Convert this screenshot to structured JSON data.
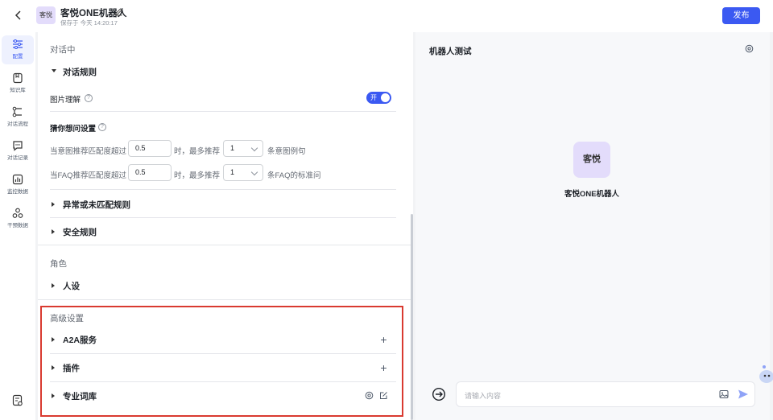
{
  "header": {
    "bot_logo_text": "客悦",
    "bot_name": "客悦ONE机器人",
    "save_time": "保存于 今天 14:20:17",
    "publish_label": "发布",
    "accent_color": "#3b59f2"
  },
  "sidebar": {
    "items": [
      {
        "label": "配置",
        "icon": "sliders-icon"
      },
      {
        "label": "知识库",
        "icon": "book-icon"
      },
      {
        "label": "对话流程",
        "icon": "flow-icon"
      },
      {
        "label": "对话记录",
        "icon": "chat-record-icon"
      },
      {
        "label": "监控数据",
        "icon": "chart-icon"
      },
      {
        "label": "干预数据",
        "icon": "nodes-icon"
      }
    ]
  },
  "config": {
    "section_dialog": "对话中",
    "dialog_rules": {
      "title": "对话规则",
      "image_understanding": {
        "label": "图片理解",
        "toggle_label": "开",
        "enabled": true
      },
      "guess_title": "猜你想问设置",
      "intent_row": {
        "prefix": "当意图推荐匹配度超过",
        "threshold": "0.5",
        "middle": "时，最多推荐",
        "count": "1",
        "suffix": "条意图例句"
      },
      "faq_row": {
        "prefix": "当FAQ推荐匹配度超过",
        "threshold": "0.5",
        "middle": "时，最多推荐",
        "count": "1",
        "suffix": "条FAQ的标准问"
      }
    },
    "abnormal_rules": "异常或未匹配规则",
    "safety_rules": "安全规则",
    "section_role": "角色",
    "persona": "人设",
    "section_advanced": "高级设置",
    "a2a": "A2A服务",
    "plugins": "插件",
    "lexicon": "专业词库"
  },
  "test_panel": {
    "title": "机器人测试",
    "avatar_text": "客悦",
    "bot_name": "客悦ONE机器人",
    "input_placeholder": "请输入内容"
  }
}
